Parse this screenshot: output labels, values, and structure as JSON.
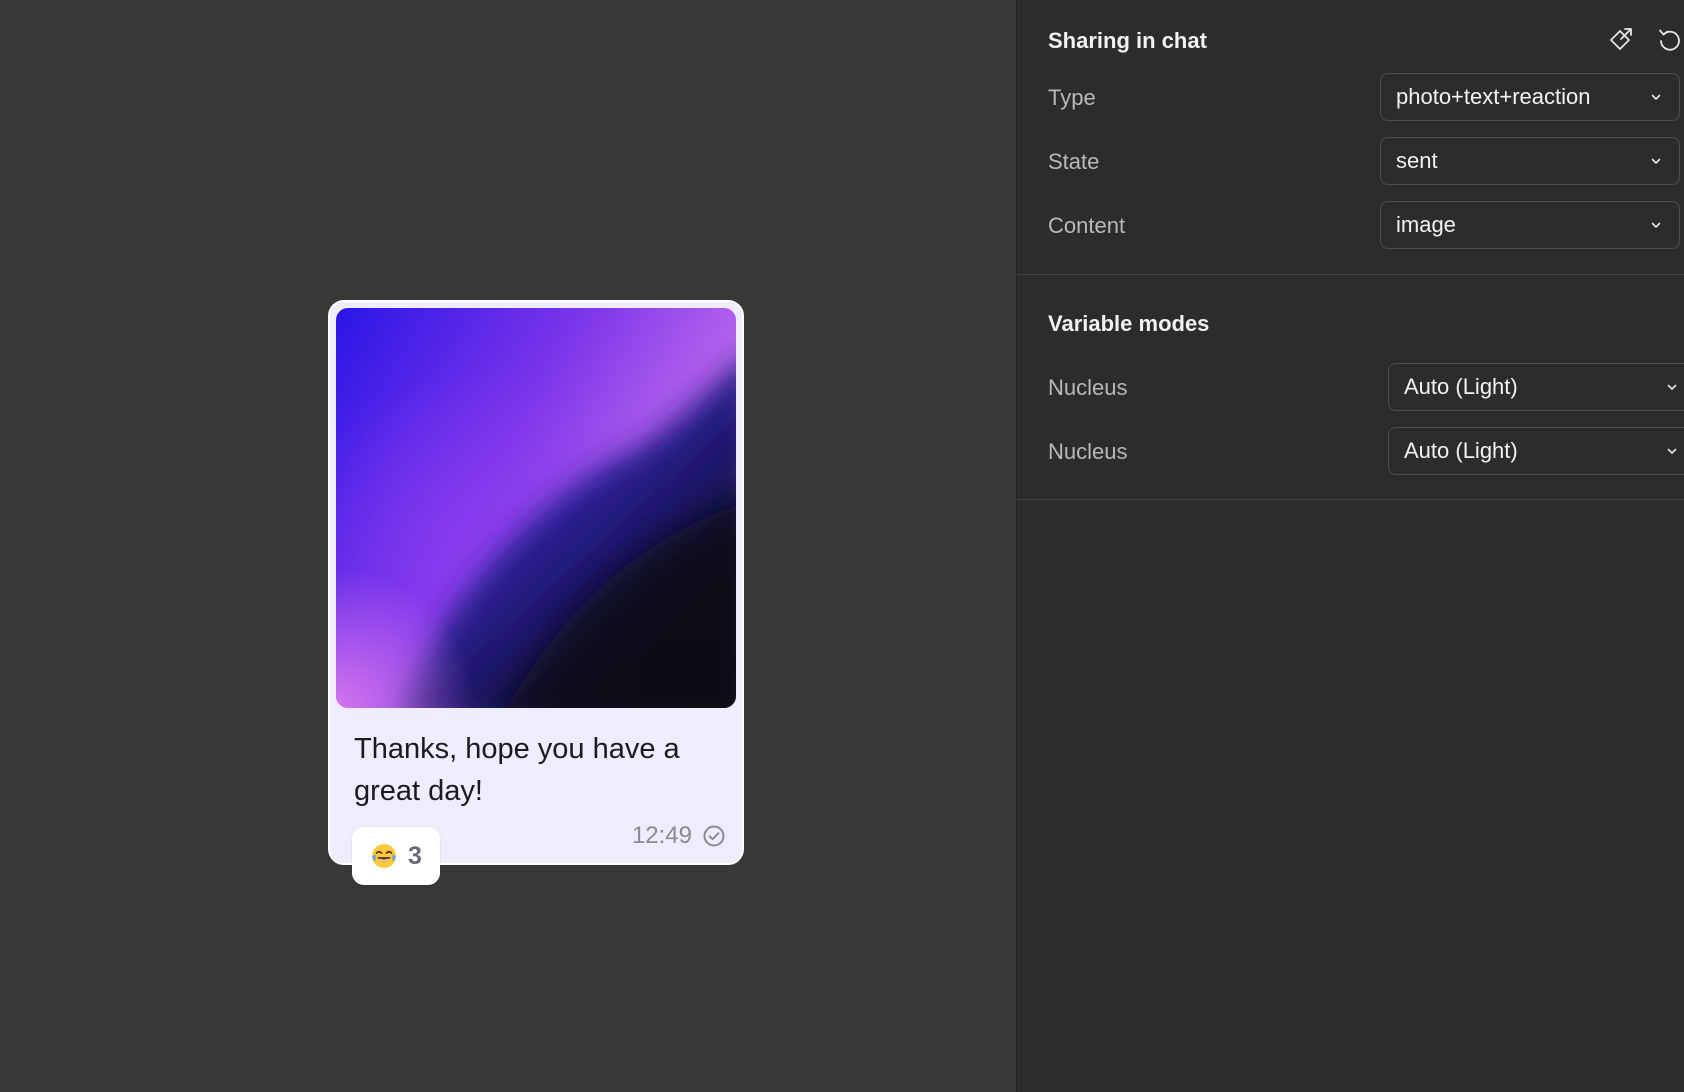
{
  "message": {
    "text": "Thanks, hope you have a great day!",
    "time": "12:49",
    "status_icon": "check-circle-icon",
    "reaction": {
      "emoji_icon": "tears-of-joy-emoji-icon",
      "count": "3"
    }
  },
  "panel": {
    "sharing": {
      "title": "Sharing in chat",
      "icons": [
        "go-to-component-icon",
        "reset-icon"
      ],
      "properties": [
        {
          "label": "Type",
          "value": "photo+text+reaction"
        },
        {
          "label": "State",
          "value": "sent"
        },
        {
          "label": "Content",
          "value": "image"
        }
      ]
    },
    "variable_modes": {
      "title": "Variable modes",
      "properties": [
        {
          "label": "Nucleus",
          "value": "Auto (Light)"
        },
        {
          "label": "Nucleus",
          "value": "Auto (Light)"
        }
      ]
    }
  },
  "colors": {
    "canvas_bg": "#383838",
    "panel_bg": "#2c2c2c",
    "bubble_bg": "#efecfc",
    "photo_blue": "#2a16e6",
    "photo_violet": "#a049ea",
    "photo_pink": "#e9a7ec",
    "photo_dark": "#0b0716"
  }
}
